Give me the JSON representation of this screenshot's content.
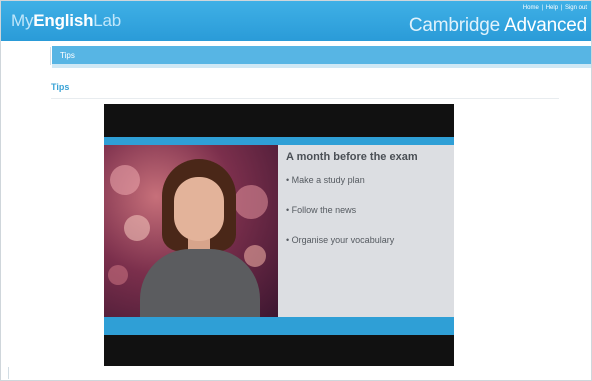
{
  "header": {
    "logo_prefix": "My",
    "logo_middle": "English",
    "logo_suffix": "Lab",
    "links": [
      "Home",
      "Help",
      "Sign out"
    ],
    "product_thin": "Cambridge",
    "product_bold": "Advanced"
  },
  "section_bar": {
    "label": "Tips"
  },
  "page": {
    "heading": "Tips"
  },
  "video": {
    "slide_heading": "A month before the exam",
    "items": [
      "• Make a study plan",
      "• Follow the news",
      "• Organise your vocabulary"
    ]
  },
  "colors": {
    "header_blue": "#2a9bd8",
    "section_blue": "#57b5e4",
    "heading_blue": "#3aa3d6",
    "slide_bar_blue": "#2f9fd6"
  }
}
